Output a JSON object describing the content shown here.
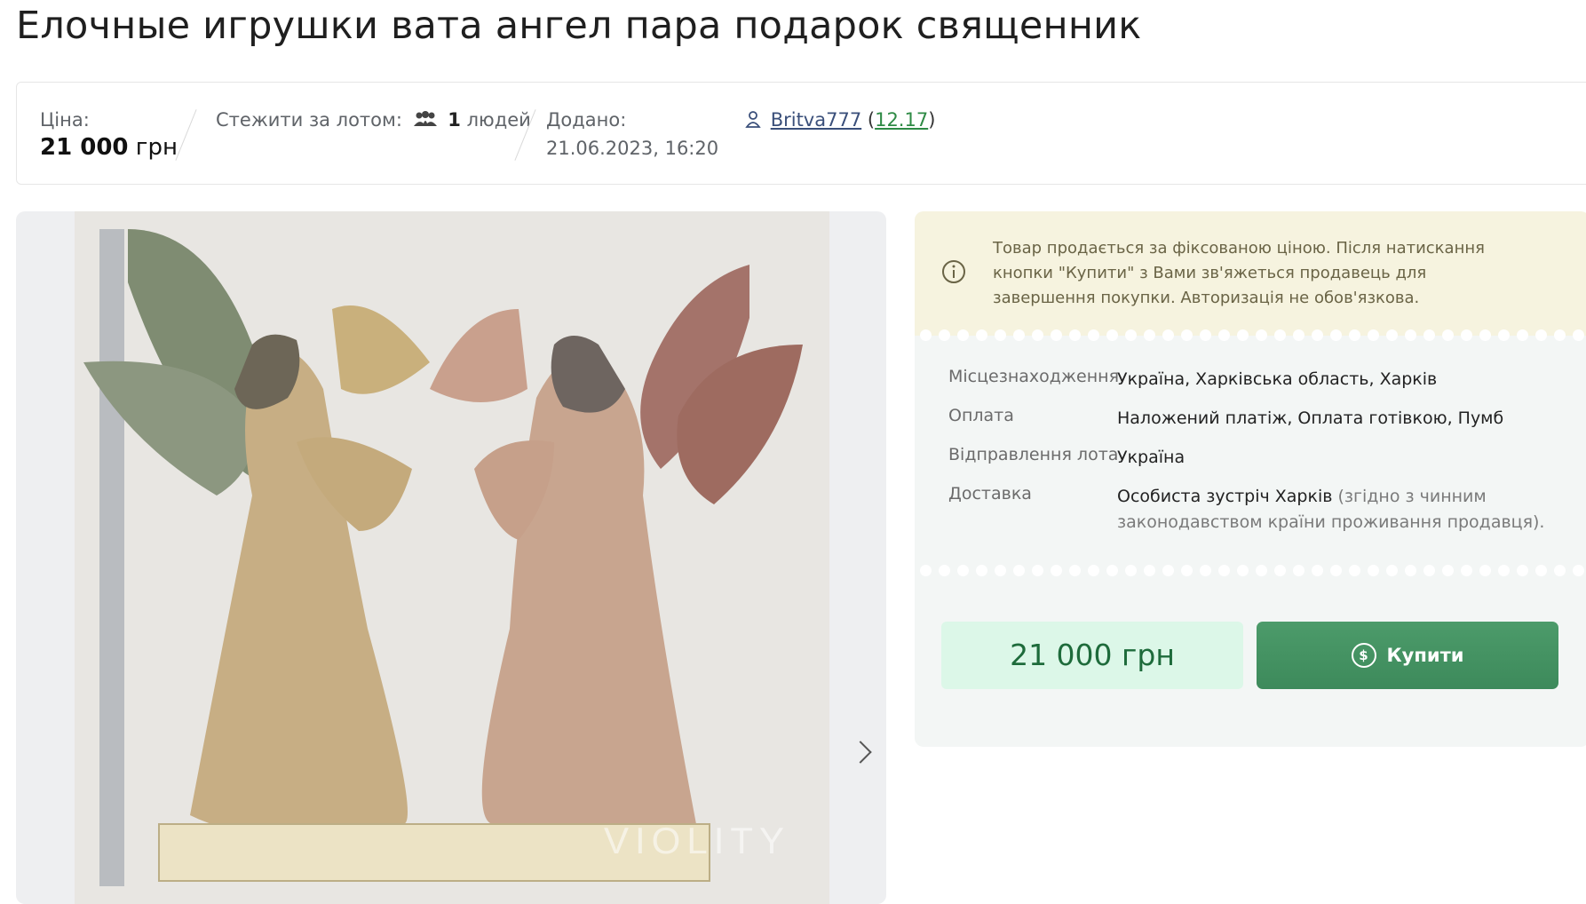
{
  "title": "Елочные игрушки вата ангел пара подарок священник",
  "info": {
    "price_label": "Ціна:",
    "price_value": "21 000",
    "price_currency": "грн",
    "watch_label": "Стежити за лотом:",
    "watch_count": "1",
    "watch_unit": "людей",
    "added_label": "Додано:",
    "added_value": "21.06.2023, 16:20",
    "seller_name": "Britva777",
    "seller_rating": "12.17"
  },
  "gallery": {
    "watermark": "VIOLITY"
  },
  "notice": {
    "text": "Товар продається за фіксованою ціною. Після натискання кнопки \"Купити\" з Вами зв'яжеться продавець для завершення покупки. Авторизація не обов'язкова."
  },
  "details": [
    {
      "label": "Місцезнаходження",
      "value": "Україна, Харківська область, Харків",
      "note": ""
    },
    {
      "label": "Оплата",
      "value": "Наложений платіж, Оплата готівкою, Пумб",
      "note": ""
    },
    {
      "label": "Відправлення лота",
      "value": "Україна",
      "note": ""
    },
    {
      "label": "Доставка",
      "value": "Особиста зустріч Харків",
      "note": "(згідно з чинним законодавством країни проживання продавця)."
    }
  ],
  "purchase": {
    "price": "21 000 грн",
    "buy_label": "Купити"
  },
  "icons": {
    "users": "users-icon",
    "person": "person-icon",
    "info": "info-icon",
    "coin": "dollar-coin-icon",
    "next": "chevron-right-icon"
  },
  "colors": {
    "accent_green": "#3d8a5b",
    "price_bg": "#dcf7e8",
    "notice_bg": "#f6f3df"
  }
}
